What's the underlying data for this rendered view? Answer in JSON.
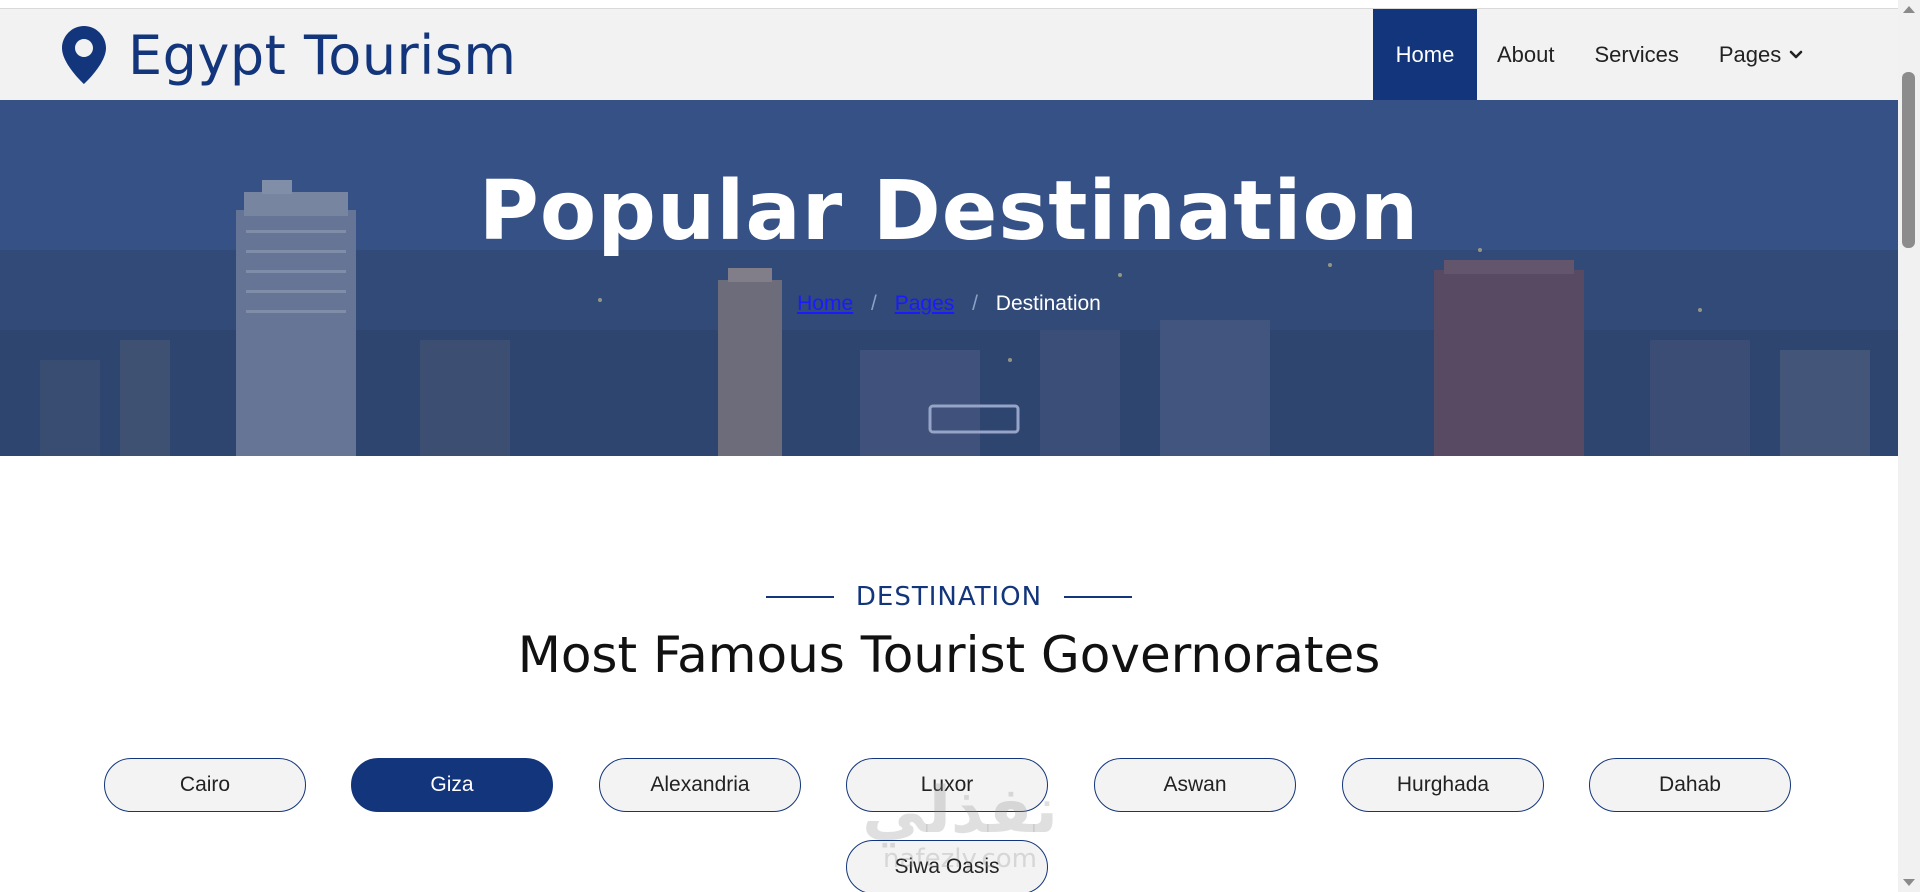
{
  "brand": {
    "name": "Egypt Tourism",
    "icon": "map-marker-icon"
  },
  "nav": {
    "items": [
      {
        "label": "Home",
        "active": true
      },
      {
        "label": "About",
        "active": false
      },
      {
        "label": "Services",
        "active": false
      },
      {
        "label": "Pages",
        "active": false,
        "dropdown": true
      }
    ]
  },
  "hero": {
    "title": "Popular Destination",
    "breadcrumb": {
      "home": "Home",
      "pages": "Pages",
      "current": "Destination",
      "separator": "/"
    }
  },
  "section": {
    "tag": "DESTINATION",
    "title": "Most Famous Tourist Governorates"
  },
  "governorates": [
    {
      "label": "Cairo",
      "active": false
    },
    {
      "label": "Giza",
      "active": true
    },
    {
      "label": "Alexandria",
      "active": false
    },
    {
      "label": "Luxor",
      "active": false
    },
    {
      "label": "Aswan",
      "active": false
    },
    {
      "label": "Hurghada",
      "active": false
    },
    {
      "label": "Dahab",
      "active": false
    },
    {
      "label": "Siwa Oasis",
      "active": false
    }
  ],
  "watermark": {
    "arabic": "نفذلي",
    "latin": "nafezly.com"
  },
  "colors": {
    "primary": "#13357B",
    "nav_bg": "#f2f2f2",
    "breadcrumb_link": "#1a1aff"
  }
}
